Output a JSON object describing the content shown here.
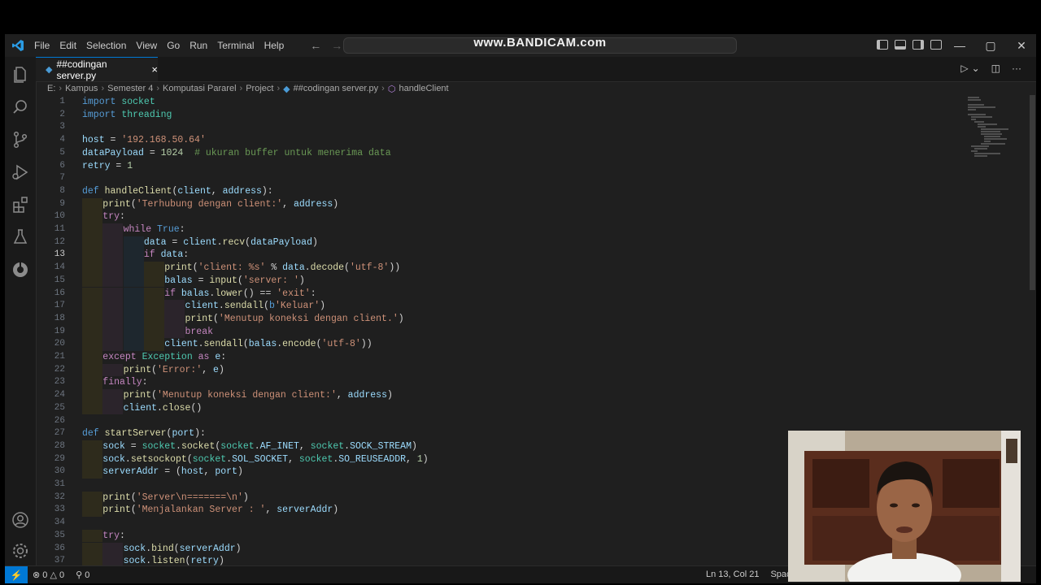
{
  "watermark": "www.BANDICAM.com",
  "menu": [
    "File",
    "Edit",
    "Selection",
    "View",
    "Go",
    "Run",
    "Terminal",
    "Help"
  ],
  "tab": {
    "label": "##codingan server.py",
    "close": "×",
    "icon": "python-file-icon"
  },
  "breadcrumb": [
    "E:",
    "Kampus",
    "Semester 4",
    "Komputasi Pararel",
    "Project",
    "##codingan server.py",
    "handleClient"
  ],
  "editor": {
    "active_line": 13,
    "lines": [
      {
        "n": "1",
        "indent": 0,
        "tokens": [
          [
            "kw",
            "import"
          ],
          [
            "p",
            " "
          ],
          [
            "cls",
            "socket"
          ]
        ]
      },
      {
        "n": "2",
        "indent": 0,
        "tokens": [
          [
            "kw",
            "import"
          ],
          [
            "p",
            " "
          ],
          [
            "cls",
            "threading"
          ]
        ]
      },
      {
        "n": "3",
        "indent": 0,
        "tokens": []
      },
      {
        "n": "4",
        "indent": 0,
        "tokens": [
          [
            "var",
            "host"
          ],
          [
            "p",
            " = "
          ],
          [
            "str",
            "'192.168.50.64'"
          ]
        ]
      },
      {
        "n": "5",
        "indent": 0,
        "tokens": [
          [
            "var",
            "dataPayload"
          ],
          [
            "p",
            " = "
          ],
          [
            "num",
            "1024"
          ],
          [
            "p",
            "  "
          ],
          [
            "cm",
            "# ukuran buffer untuk menerima data"
          ]
        ]
      },
      {
        "n": "6",
        "indent": 0,
        "tokens": [
          [
            "var",
            "retry"
          ],
          [
            "p",
            " = "
          ],
          [
            "num",
            "1"
          ]
        ]
      },
      {
        "n": "7",
        "indent": 0,
        "tokens": []
      },
      {
        "n": "8",
        "indent": 0,
        "tokens": [
          [
            "kw",
            "def"
          ],
          [
            "p",
            " "
          ],
          [
            "fn",
            "handleClient"
          ],
          [
            "p",
            "("
          ],
          [
            "var",
            "client"
          ],
          [
            "p",
            ", "
          ],
          [
            "var",
            "address"
          ],
          [
            "p",
            "):"
          ]
        ]
      },
      {
        "n": "9",
        "indent": 1,
        "tokens": [
          [
            "fn",
            "print"
          ],
          [
            "p",
            "("
          ],
          [
            "str",
            "'Terhubung dengan client:'"
          ],
          [
            "p",
            ", "
          ],
          [
            "var",
            "address"
          ],
          [
            "p",
            ")"
          ]
        ]
      },
      {
        "n": "10",
        "indent": 1,
        "tokens": [
          [
            "ctl",
            "try"
          ],
          [
            "p",
            ":"
          ]
        ]
      },
      {
        "n": "11",
        "indent": 2,
        "tokens": [
          [
            "ctl",
            "while"
          ],
          [
            "p",
            " "
          ],
          [
            "kw",
            "True"
          ],
          [
            "p",
            ":"
          ]
        ]
      },
      {
        "n": "12",
        "indent": 3,
        "tokens": [
          [
            "var",
            "data"
          ],
          [
            "p",
            " = "
          ],
          [
            "var",
            "client"
          ],
          [
            "p",
            "."
          ],
          [
            "fn",
            "recv"
          ],
          [
            "p",
            "("
          ],
          [
            "var",
            "dataPayload"
          ],
          [
            "p",
            ")"
          ]
        ]
      },
      {
        "n": "13",
        "indent": 3,
        "tokens": [
          [
            "ctl",
            "if"
          ],
          [
            "p",
            " "
          ],
          [
            "var",
            "data"
          ],
          [
            "p",
            ":"
          ]
        ]
      },
      {
        "n": "14",
        "indent": 4,
        "tokens": [
          [
            "fn",
            "print"
          ],
          [
            "p",
            "("
          ],
          [
            "str",
            "'client: %s'"
          ],
          [
            "p",
            " % "
          ],
          [
            "var",
            "data"
          ],
          [
            "p",
            "."
          ],
          [
            "fn",
            "decode"
          ],
          [
            "p",
            "("
          ],
          [
            "str",
            "'utf-8'"
          ],
          [
            "p",
            "))"
          ]
        ]
      },
      {
        "n": "15",
        "indent": 4,
        "tokens": [
          [
            "var",
            "balas"
          ],
          [
            "p",
            " = "
          ],
          [
            "fn",
            "input"
          ],
          [
            "p",
            "("
          ],
          [
            "str",
            "'server: '"
          ],
          [
            "p",
            ")"
          ]
        ]
      },
      {
        "n": "16",
        "indent": 4,
        "tokens": [
          [
            "ctl",
            "if"
          ],
          [
            "p",
            " "
          ],
          [
            "var",
            "balas"
          ],
          [
            "p",
            "."
          ],
          [
            "fn",
            "lower"
          ],
          [
            "p",
            "() == "
          ],
          [
            "str",
            "'exit'"
          ],
          [
            "p",
            ":"
          ]
        ]
      },
      {
        "n": "17",
        "indent": 5,
        "tokens": [
          [
            "var",
            "client"
          ],
          [
            "p",
            "."
          ],
          [
            "fn",
            "sendall"
          ],
          [
            "p",
            "("
          ],
          [
            "kw",
            "b"
          ],
          [
            "str",
            "'Keluar'"
          ],
          [
            "p",
            ")"
          ]
        ]
      },
      {
        "n": "18",
        "indent": 5,
        "tokens": [
          [
            "fn",
            "print"
          ],
          [
            "p",
            "("
          ],
          [
            "str",
            "'Menutup koneksi dengan client.'"
          ],
          [
            "p",
            ")"
          ]
        ]
      },
      {
        "n": "19",
        "indent": 5,
        "tokens": [
          [
            "ctl",
            "break"
          ]
        ]
      },
      {
        "n": "20",
        "indent": 4,
        "tokens": [
          [
            "var",
            "client"
          ],
          [
            "p",
            "."
          ],
          [
            "fn",
            "sendall"
          ],
          [
            "p",
            "("
          ],
          [
            "var",
            "balas"
          ],
          [
            "p",
            "."
          ],
          [
            "fn",
            "encode"
          ],
          [
            "p",
            "("
          ],
          [
            "str",
            "'utf-8'"
          ],
          [
            "p",
            "))"
          ]
        ]
      },
      {
        "n": "21",
        "indent": 1,
        "tokens": [
          [
            "ctl",
            "except"
          ],
          [
            "p",
            " "
          ],
          [
            "cls",
            "Exception"
          ],
          [
            "p",
            " "
          ],
          [
            "ctl",
            "as"
          ],
          [
            "p",
            " "
          ],
          [
            "var",
            "e"
          ],
          [
            "p",
            ":"
          ]
        ]
      },
      {
        "n": "22",
        "indent": 2,
        "tokens": [
          [
            "fn",
            "print"
          ],
          [
            "p",
            "("
          ],
          [
            "str",
            "'Error:'"
          ],
          [
            "p",
            ", "
          ],
          [
            "var",
            "e"
          ],
          [
            "p",
            ")"
          ]
        ]
      },
      {
        "n": "23",
        "indent": 1,
        "tokens": [
          [
            "ctl",
            "finally"
          ],
          [
            "p",
            ":"
          ]
        ]
      },
      {
        "n": "24",
        "indent": 2,
        "tokens": [
          [
            "fn",
            "print"
          ],
          [
            "p",
            "("
          ],
          [
            "str",
            "'Menutup koneksi dengan client:'"
          ],
          [
            "p",
            ", "
          ],
          [
            "var",
            "address"
          ],
          [
            "p",
            ")"
          ]
        ]
      },
      {
        "n": "25",
        "indent": 2,
        "tokens": [
          [
            "var",
            "client"
          ],
          [
            "p",
            "."
          ],
          [
            "fn",
            "close"
          ],
          [
            "p",
            "()"
          ]
        ]
      },
      {
        "n": "26",
        "indent": 0,
        "tokens": []
      },
      {
        "n": "27",
        "indent": 0,
        "tokens": [
          [
            "kw",
            "def"
          ],
          [
            "p",
            " "
          ],
          [
            "fn",
            "startServer"
          ],
          [
            "p",
            "("
          ],
          [
            "var",
            "port"
          ],
          [
            "p",
            "):"
          ]
        ]
      },
      {
        "n": "28",
        "indent": 1,
        "tokens": [
          [
            "var",
            "sock"
          ],
          [
            "p",
            " = "
          ],
          [
            "cls",
            "socket"
          ],
          [
            "p",
            "."
          ],
          [
            "fn",
            "socket"
          ],
          [
            "p",
            "("
          ],
          [
            "cls",
            "socket"
          ],
          [
            "p",
            "."
          ],
          [
            "var",
            "AF_INET"
          ],
          [
            "p",
            ", "
          ],
          [
            "cls",
            "socket"
          ],
          [
            "p",
            "."
          ],
          [
            "var",
            "SOCK_STREAM"
          ],
          [
            "p",
            ")"
          ]
        ]
      },
      {
        "n": "29",
        "indent": 1,
        "tokens": [
          [
            "var",
            "sock"
          ],
          [
            "p",
            "."
          ],
          [
            "fn",
            "setsockopt"
          ],
          [
            "p",
            "("
          ],
          [
            "cls",
            "socket"
          ],
          [
            "p",
            "."
          ],
          [
            "var",
            "SOL_SOCKET"
          ],
          [
            "p",
            ", "
          ],
          [
            "cls",
            "socket"
          ],
          [
            "p",
            "."
          ],
          [
            "var",
            "SO_REUSEADDR"
          ],
          [
            "p",
            ", "
          ],
          [
            "num",
            "1"
          ],
          [
            "p",
            ")"
          ]
        ]
      },
      {
        "n": "30",
        "indent": 1,
        "tokens": [
          [
            "var",
            "serverAddr"
          ],
          [
            "p",
            " = ("
          ],
          [
            "var",
            "host"
          ],
          [
            "p",
            ", "
          ],
          [
            "var",
            "port"
          ],
          [
            "p",
            ")"
          ]
        ]
      },
      {
        "n": "31",
        "indent": 0,
        "tokens": []
      },
      {
        "n": "32",
        "indent": 1,
        "tokens": [
          [
            "fn",
            "print"
          ],
          [
            "p",
            "("
          ],
          [
            "str",
            "'Server\\n=======\\n'"
          ],
          [
            "p",
            ")"
          ]
        ]
      },
      {
        "n": "33",
        "indent": 1,
        "tokens": [
          [
            "fn",
            "print"
          ],
          [
            "p",
            "("
          ],
          [
            "str",
            "'Menjalankan Server : '"
          ],
          [
            "p",
            ", "
          ],
          [
            "var",
            "serverAddr"
          ],
          [
            "p",
            ")"
          ]
        ]
      },
      {
        "n": "34",
        "indent": 0,
        "tokens": []
      },
      {
        "n": "35",
        "indent": 1,
        "tokens": [
          [
            "ctl",
            "try"
          ],
          [
            "p",
            ":"
          ]
        ]
      },
      {
        "n": "36",
        "indent": 2,
        "tokens": [
          [
            "var",
            "sock"
          ],
          [
            "p",
            "."
          ],
          [
            "fn",
            "bind"
          ],
          [
            "p",
            "("
          ],
          [
            "var",
            "serverAddr"
          ],
          [
            "p",
            ")"
          ]
        ]
      },
      {
        "n": "37",
        "indent": 2,
        "tokens": [
          [
            "var",
            "sock"
          ],
          [
            "p",
            "."
          ],
          [
            "fn",
            "listen"
          ],
          [
            "p",
            "("
          ],
          [
            "var",
            "retry"
          ],
          [
            "p",
            ")"
          ]
        ]
      }
    ]
  },
  "statusbar": {
    "errors": "0",
    "warnings": "0",
    "ports": "0",
    "cursor": "Ln 13, Col 21",
    "spaces": "Spaces"
  },
  "icons": {
    "activity": [
      "explorer-icon",
      "search-icon",
      "source-control-icon",
      "run-debug-icon",
      "extensions-icon",
      "testing-icon",
      "remote-explorer-icon",
      "account-icon",
      "settings-gear-icon"
    ]
  }
}
